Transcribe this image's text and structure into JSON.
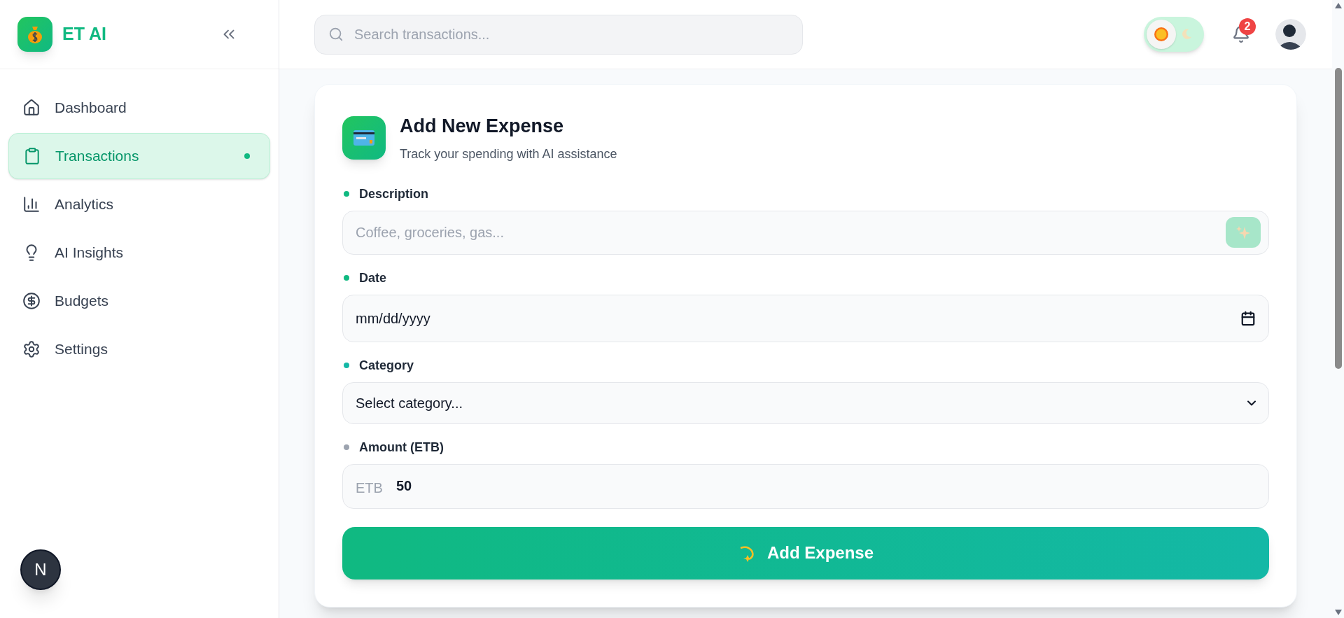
{
  "sidebar": {
    "brand": "ET AI",
    "items": [
      {
        "label": "Dashboard",
        "selected": false
      },
      {
        "label": "Transactions",
        "selected": true
      },
      {
        "label": "Analytics",
        "selected": false
      },
      {
        "label": "AI Insights",
        "selected": false
      },
      {
        "label": "Budgets",
        "selected": false
      },
      {
        "label": "Settings",
        "selected": false
      }
    ]
  },
  "dev_badge": {
    "label": "N"
  },
  "header": {
    "search": {
      "placeholder": "Search transactions..."
    },
    "theme_toggle": {
      "on": false
    },
    "notifications": {
      "count": "2"
    }
  },
  "form": {
    "title": "Add New Expense",
    "subtitle": "Track your spending with AI assistance",
    "fields": [
      {
        "kind": "text",
        "label": "Description",
        "color": "#10b981",
        "placeholder": "Coffee, groceries, gas..."
      },
      {
        "kind": "date",
        "label": "Date",
        "color": "#10b981",
        "value": "mm/dd/yyyy"
      },
      {
        "kind": "select",
        "label": "Category",
        "color": "#14b8a6",
        "value": "Select category..."
      },
      {
        "kind": "amount",
        "label": "Amount (ETB)",
        "color": "#9ca3af",
        "prefix": "ETB",
        "value": "50"
      }
    ],
    "submit": "Add Expense"
  }
}
